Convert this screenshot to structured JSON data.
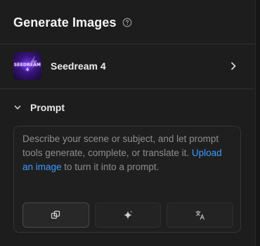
{
  "header": {
    "title": "Generate Images",
    "help_icon": "question-circle-icon"
  },
  "model": {
    "name": "Seedream 4",
    "thumbnail_text": "SEEDREAM 4",
    "chevron_icon": "chevron-right-icon"
  },
  "prompt_section": {
    "title": "Prompt",
    "collapse_icon": "chevron-down-icon",
    "placeholder_before": "Describe your scene or subject, and let prompt tools generate, complete, or translate it. ",
    "link_text": "Upload an image",
    "placeholder_after": " to turn it into a prompt.",
    "tools": [
      {
        "name": "prompt-generate-tool",
        "icon": "copy-swap-icon",
        "active": true
      },
      {
        "name": "prompt-complete-tool",
        "icon": "sparkle-icon",
        "active": false
      },
      {
        "name": "prompt-translate-tool",
        "icon": "translate-icon",
        "active": false
      }
    ]
  },
  "colors": {
    "background": "#1d1d1d",
    "link": "#3d9bff",
    "text_primary": "#f5f5f5",
    "text_placeholder": "#8e8e8e",
    "thumbnail_accent": "#7b3cff"
  }
}
